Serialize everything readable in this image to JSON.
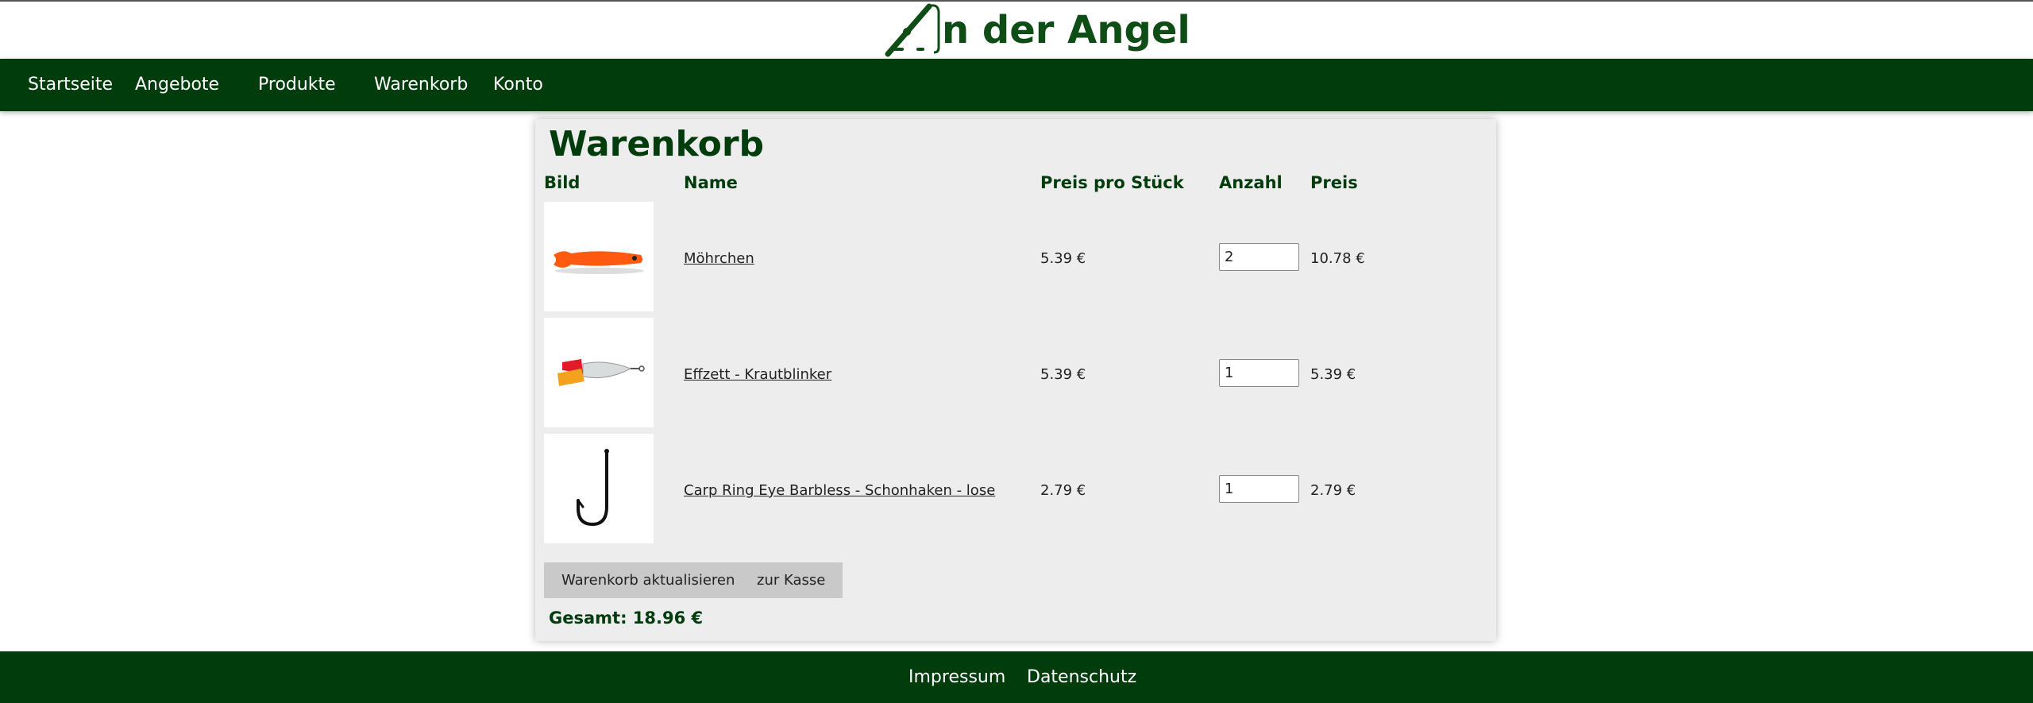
{
  "brand": {
    "logo_text": "n der Angel",
    "logo_icon": "fishing-rod-icon",
    "color": "#0f4d16"
  },
  "nav": {
    "items": [
      "Startseite",
      "Angebote",
      "Produkte",
      "Warenkorb",
      "Konto"
    ]
  },
  "cart": {
    "title": "Warenkorb",
    "headers": {
      "image": "Bild",
      "name": "Name",
      "unit_price": "Preis pro Stück",
      "quantity": "Anzahl",
      "price": "Preis"
    },
    "items": [
      {
        "name": "Möhrchen",
        "unit_price": "5.39 €",
        "quantity": "2",
        "price": "10.78 €",
        "image": "orange-soft-bait-image"
      },
      {
        "name": "Effzett - Krautblinker",
        "unit_price": "5.39 €",
        "quantity": "1",
        "price": "5.39 €",
        "image": "spinner-lure-image"
      },
      {
        "name": "Carp Ring Eye Barbless - Schonhaken - lose",
        "unit_price": "2.79 €",
        "quantity": "1",
        "price": "2.79 €",
        "image": "fishing-hook-image"
      }
    ],
    "update_button": "Warenkorb aktualisieren",
    "checkout_button": "zur Kasse",
    "total_label": "Gesamt: 18.96 €"
  },
  "footer": {
    "links": [
      "Impressum",
      "Datenschutz"
    ]
  },
  "colors": {
    "primary": "#003c0c",
    "card_bg": "#ededed",
    "button_bg": "#c9c9c9"
  }
}
